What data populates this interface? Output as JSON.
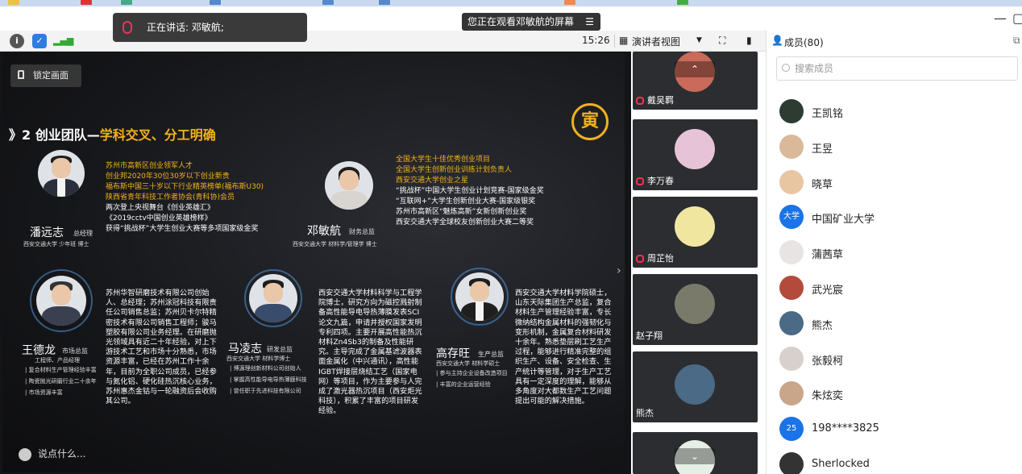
{
  "app": {
    "viewing_banner": "您正在观看邓敏航的屏幕",
    "speaking_label": "正在讲话: 邓敏航;"
  },
  "toolbar": {
    "time": "15:26",
    "view_mode": "演讲者视图",
    "members_label": "成员(80)"
  },
  "slide": {
    "lock_label": "锁定画面",
    "title_prefix": "》2 创业团队—",
    "title_highlight": "学科交叉、分工明确",
    "logo_glyph": "寅",
    "people": [
      {
        "name": "潘远志",
        "role": "总经理",
        "school": "西安交通大学 少年班 博士",
        "bullets_yellow": [
          "苏州市高新区创业领军人才",
          "创业邦2020年30位30岁以下创业新贵",
          "福布斯中国三十岁以下行业精英榜单(福布斯U30)",
          "陕西省青年科技工作者协会(青科协)会员"
        ],
        "bullets_white": [
          "两次登上央视舞台《创业英雄汇》",
          "《2019cctv中国创业英雄榜样》",
          "获得“挑战杯”大学生创业大赛等多项国家级金奖"
        ]
      },
      {
        "name": "邓敏航",
        "role": "财务总监",
        "school": "西安交通大学 材料学/管理学 博士",
        "bullets_yellow": [
          "全国大学生十佳优秀创业项目",
          "全国大学生创新创业训练计划负责人",
          "西安交通大学创业之星"
        ],
        "bullets_white": [
          "“挑战杯”中国大学生创业计划竞赛-国家级金奖",
          "“互联网+”大学生创新创业大赛-国家级银奖",
          "苏州市高新区“魅炼高新”女新创新创业奖",
          "西安交通大学全球校友创新创业大赛二等奖"
        ]
      },
      {
        "name": "王德龙",
        "role": "市场总监",
        "school": "工程师、产品经理",
        "lines": [
          "| 复合材料生产管理经验丰富",
          "| 陶瓷抛光研磨行业二十余年",
          "| 市场资源丰富"
        ],
        "para": "苏州华智研磨技术有限公司创始人、总经理；苏州涂冠科技有限责任公司销售总监；苏州贝卡尔特精密技术有限公司销售工程师；骏马塑胶有限公司业务经理。在研磨抛光领域具有近二十年经验，对上下游技术工艺和市场十分熟悉，市场资源丰富，已经在苏州工作十余年，目前为全职公司成员，已经参与氮化铝、硬化硅热沉核心业务，苏州惠杰金钴与一轮融资后会收购其公司。"
      },
      {
        "name": "马凌志",
        "role": "研发总监",
        "school": "西安交通大学 材料学博士",
        "lines": [
          "| 博源理创新材料公司创始人",
          "| 掌握高性能导电导热薄膜科技",
          "| 曾任职于先进科技有限公司"
        ],
        "para": "西安交通大学材料科学与工程学院博士，研究方向为磁控溅射制备高性能导电导热薄膜发表SCI论文九篇，申请并授权国家发明专利四项。主要开展高性能热沉材料Zn4Sb3的制备及性能研究。主导完成了金属基滤波器表面金属化（中兴通讯），高性能IGBT焊接层烧结工艺（国家电网）等项目，作为主要参与人完成了激光器热沉项目（西安炬光科技），积累了丰富的项目研发经验。"
      },
      {
        "name": "高存旺",
        "role": "生产总监",
        "school": "西安交通大学 材料学硕士",
        "lines": [
          "| 参与主持企业设备改造项目",
          "| 丰富的企业运营经验"
        ],
        "para": "西安交通大学材料学院硕士，山东天际集团生产总监，复合材料生产管理经验丰富，专长微纳结构金属材料的强韧化与变形机制，金属复合材料研发十余年。熟悉垫层刷工艺生产过程，能够进行精准完整的组织生产、设备、安全检查、生产统计等管理，对于生产工艺具有一定深度的理解，能够从多角度对大都数生产工艺问题提出可能的解决措施。"
      }
    ],
    "comment_placeholder": "说点什么..."
  },
  "tiles": [
    {
      "name": "戴吴羁"
    },
    {
      "name": "李万春"
    },
    {
      "name": "周芷怡"
    },
    {
      "name": "赵子翔"
    },
    {
      "name": "熊杰"
    }
  ],
  "members_panel": {
    "search_placeholder": "搜索成员",
    "members": [
      {
        "name": "王凯铭",
        "avatar_color": "#2e3b33"
      },
      {
        "name": "王昱",
        "avatar_color": "#d9b99a"
      },
      {
        "name": "晓草",
        "avatar_color": "#e8c6a2"
      },
      {
        "name": "中国矿业大学",
        "avatar_color": "#1a73e8",
        "avatar_text": "大学"
      },
      {
        "name": "蒲茜草",
        "avatar_color": "#e8e4e4"
      },
      {
        "name": "武光宸",
        "avatar_color": "#b34a3c"
      },
      {
        "name": "熊杰",
        "avatar_color": "#4a6a86"
      },
      {
        "name": "张毅柯",
        "avatar_color": "#d8d0cc"
      },
      {
        "name": "朱炫奕",
        "avatar_color": "#c9a68a"
      },
      {
        "name": "198****3825",
        "avatar_color": "#1a73e8",
        "avatar_text": "25"
      },
      {
        "name": "Sherlocked",
        "avatar_color": "#333333"
      }
    ]
  }
}
